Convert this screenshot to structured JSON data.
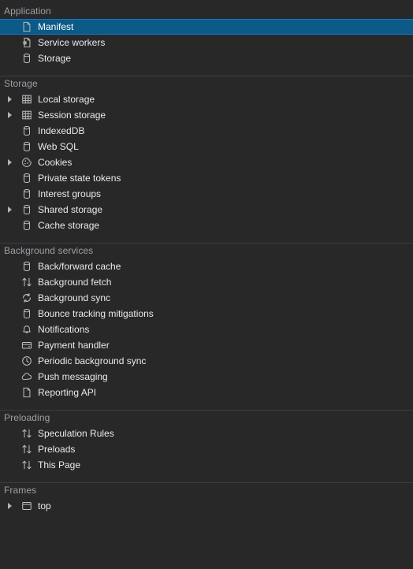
{
  "panel": {
    "name": "Application panel sidebar",
    "background_color": "#282828",
    "text_color": "#e8eaed",
    "header_color": "#9aa0a6",
    "selection_color": "#0b5a87",
    "selection_border_color": "#1a73c8",
    "separator_color": "#3d3d3d"
  },
  "sections": [
    {
      "id": "application",
      "title": "Application",
      "items": [
        {
          "label": "Manifest",
          "icon": "document-icon",
          "expandable": false,
          "selected": true
        },
        {
          "label": "Service workers",
          "icon": "service-worker-icon",
          "expandable": false,
          "selected": false
        },
        {
          "label": "Storage",
          "icon": "database-icon",
          "expandable": false,
          "selected": false
        }
      ]
    },
    {
      "id": "storage",
      "title": "Storage",
      "items": [
        {
          "label": "Local storage",
          "icon": "table-icon",
          "expandable": true,
          "selected": false
        },
        {
          "label": "Session storage",
          "icon": "table-icon",
          "expandable": true,
          "selected": false
        },
        {
          "label": "IndexedDB",
          "icon": "database-icon",
          "expandable": false,
          "selected": false
        },
        {
          "label": "Web SQL",
          "icon": "database-icon",
          "expandable": false,
          "selected": false
        },
        {
          "label": "Cookies",
          "icon": "cookie-icon",
          "expandable": true,
          "selected": false
        },
        {
          "label": "Private state tokens",
          "icon": "database-icon",
          "expandable": false,
          "selected": false
        },
        {
          "label": "Interest groups",
          "icon": "database-icon",
          "expandable": false,
          "selected": false
        },
        {
          "label": "Shared storage",
          "icon": "database-icon",
          "expandable": true,
          "selected": false
        },
        {
          "label": "Cache storage",
          "icon": "database-icon",
          "expandable": false,
          "selected": false
        }
      ]
    },
    {
      "id": "background-services",
      "title": "Background services",
      "items": [
        {
          "label": "Back/forward cache",
          "icon": "database-icon",
          "expandable": false,
          "selected": false
        },
        {
          "label": "Background fetch",
          "icon": "arrows-up-down-icon",
          "expandable": false,
          "selected": false
        },
        {
          "label": "Background sync",
          "icon": "sync-icon",
          "expandable": false,
          "selected": false
        },
        {
          "label": "Bounce tracking mitigations",
          "icon": "database-icon",
          "expandable": false,
          "selected": false
        },
        {
          "label": "Notifications",
          "icon": "bell-icon",
          "expandable": false,
          "selected": false
        },
        {
          "label": "Payment handler",
          "icon": "credit-card-icon",
          "expandable": false,
          "selected": false
        },
        {
          "label": "Periodic background sync",
          "icon": "clock-icon",
          "expandable": false,
          "selected": false
        },
        {
          "label": "Push messaging",
          "icon": "cloud-icon",
          "expandable": false,
          "selected": false
        },
        {
          "label": "Reporting API",
          "icon": "document-icon",
          "expandable": false,
          "selected": false
        }
      ]
    },
    {
      "id": "preloading",
      "title": "Preloading",
      "items": [
        {
          "label": "Speculation Rules",
          "icon": "arrows-up-down-icon",
          "expandable": false,
          "selected": false
        },
        {
          "label": "Preloads",
          "icon": "arrows-up-down-icon",
          "expandable": false,
          "selected": false
        },
        {
          "label": "This Page",
          "icon": "arrows-up-down-icon",
          "expandable": false,
          "selected": false
        }
      ]
    },
    {
      "id": "frames",
      "title": "Frames",
      "items": [
        {
          "label": "top",
          "icon": "frame-icon",
          "expandable": true,
          "selected": false
        }
      ]
    }
  ]
}
